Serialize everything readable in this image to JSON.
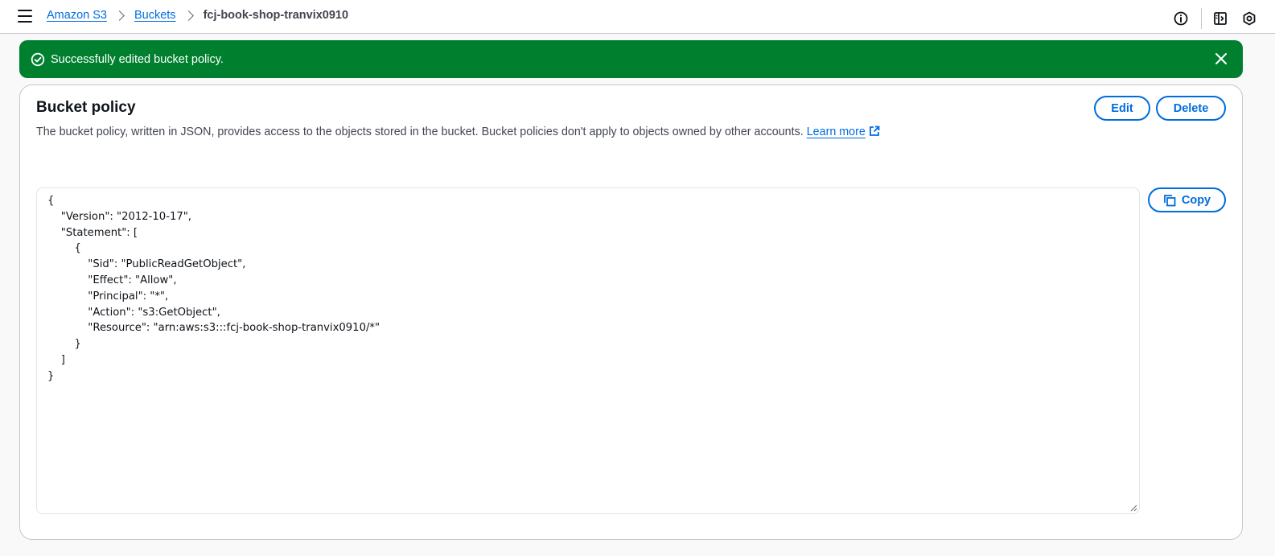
{
  "breadcrumb": {
    "items": [
      {
        "label": "Amazon S3"
      },
      {
        "label": "Buckets"
      }
    ],
    "current": "fcj-book-shop-tranvix0910"
  },
  "top_icons": [
    "info-icon",
    "notifications-panel-icon",
    "settings-icon"
  ],
  "flash": {
    "message": "Successfully edited bucket policy.",
    "color": "#00802f"
  },
  "panel": {
    "title": "Bucket policy",
    "description": "The bucket policy, written in JSON, provides access to the objects stored in the bucket. Bucket policies don't apply to objects owned by other accounts.",
    "learn_more": "Learn more",
    "edit_label": "Edit",
    "delete_label": "Delete",
    "copy_label": "Copy",
    "policy_json": "{\n    \"Version\": \"2012-10-17\",\n    \"Statement\": [\n        {\n            \"Sid\": \"PublicReadGetObject\",\n            \"Effect\": \"Allow\",\n            \"Principal\": \"*\",\n            \"Action\": \"s3:GetObject\",\n            \"Resource\": \"arn:aws:s3:::fcj-book-shop-tranvix0910/*\"\n        }\n    ]\n}"
  },
  "colors": {
    "link": "#006ce0",
    "text": "#0f141a",
    "secondary_text": "#424650",
    "border": "#c6c6cd"
  }
}
